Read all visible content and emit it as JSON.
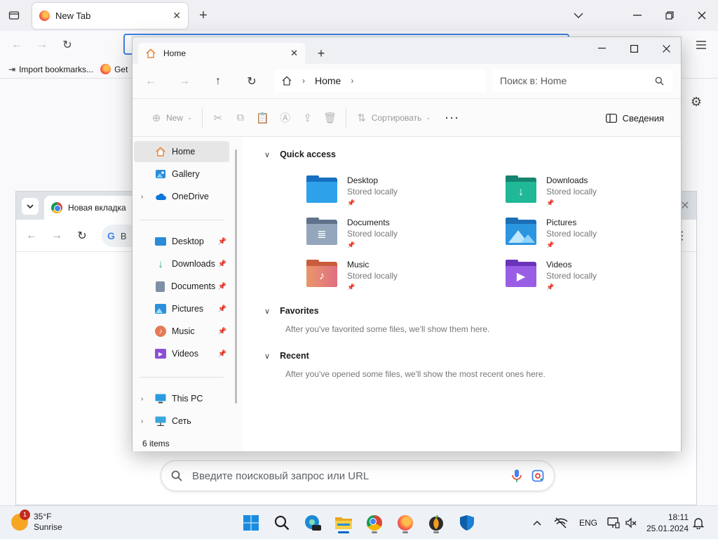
{
  "firefox": {
    "tab_title": "New Tab",
    "bookmarks": [
      {
        "label": "Import bookmarks..."
      },
      {
        "label": "Get"
      }
    ]
  },
  "chrome": {
    "tab_title": "Новая вкладка",
    "omnibox_text": "В",
    "search_placeholder": "Введите поисковый запрос или URL"
  },
  "explorer": {
    "tab_title": "Home",
    "breadcrumb": "Home",
    "search_placeholder": "Поиск в: Home",
    "commands": {
      "new_label": "New",
      "sort_label": "Сортировать",
      "more_label": "···",
      "details_label": "Сведения"
    },
    "nav": {
      "top": [
        {
          "label": "Home",
          "selected": true,
          "icon": "home-icon"
        },
        {
          "label": "Gallery",
          "icon": "gallery-icon"
        },
        {
          "label": "OneDrive",
          "icon": "onedrive-icon",
          "expandable": true
        }
      ],
      "pinned": [
        {
          "label": "Desktop",
          "icon": "desktop-folder-icon"
        },
        {
          "label": "Downloads",
          "icon": "downloads-folder-icon"
        },
        {
          "label": "Documents",
          "icon": "documents-folder-icon"
        },
        {
          "label": "Pictures",
          "icon": "pictures-folder-icon"
        },
        {
          "label": "Music",
          "icon": "music-folder-icon"
        },
        {
          "label": "Videos",
          "icon": "videos-folder-icon"
        }
      ],
      "bottom": [
        {
          "label": "This PC",
          "icon": "this-pc-icon",
          "expandable": true
        },
        {
          "label": "Сеть",
          "icon": "network-icon",
          "expandable": true
        }
      ]
    },
    "status": "6 items",
    "quick_access": {
      "title": "Quick access",
      "items": [
        {
          "name": "Desktop",
          "sub": "Stored locally",
          "color": "#2a8bd8"
        },
        {
          "name": "Downloads",
          "sub": "Stored locally",
          "color": "#1ba58a"
        },
        {
          "name": "Documents",
          "sub": "Stored locally",
          "color": "#7d90a6"
        },
        {
          "name": "Pictures",
          "sub": "Stored locally",
          "color": "#2c8fdc"
        },
        {
          "name": "Music",
          "sub": "Stored locally",
          "color": "#e47a57"
        },
        {
          "name": "Videos",
          "sub": "Stored locally",
          "color": "#8a4fd6"
        }
      ]
    },
    "favorites": {
      "title": "Favorites",
      "note": "After you've favorited some files, we'll show them here."
    },
    "recent": {
      "title": "Recent",
      "note": "After you've opened some files, we'll show the most recent ones here."
    }
  },
  "taskbar": {
    "weather": {
      "temp": "35°F",
      "desc": "Sunrise",
      "badge": "1"
    },
    "lang": "ENG",
    "time": "18:11",
    "date": "25.01.2024"
  }
}
